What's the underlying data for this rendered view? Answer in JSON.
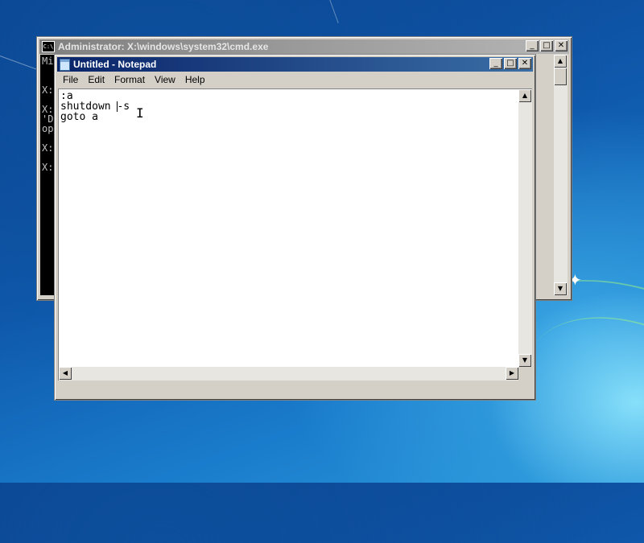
{
  "cmd_window": {
    "title": "Administrator: X:\\windows\\system32\\cmd.exe",
    "icon": "cmd-icon",
    "visible_line_fragments": [
      "Mi",
      "X:",
      "X:",
      "'D",
      "op",
      "X:",
      "X:"
    ]
  },
  "notepad_window": {
    "title": "Untitled - Notepad",
    "icon": "notepad-icon",
    "menu": [
      "File",
      "Edit",
      "Format",
      "View",
      "Help"
    ],
    "content_lines": [
      ":a",
      "shutdown -s",
      "goto a"
    ]
  },
  "title_buttons": {
    "minimize": "_",
    "maximize": "□",
    "close": "✕"
  },
  "colors": {
    "desktop": "#0f5aad",
    "title_active": "#0a246a",
    "title_inactive": "#808080",
    "cmd_background": "#000000",
    "cmd_text": "#c0c0c0"
  }
}
